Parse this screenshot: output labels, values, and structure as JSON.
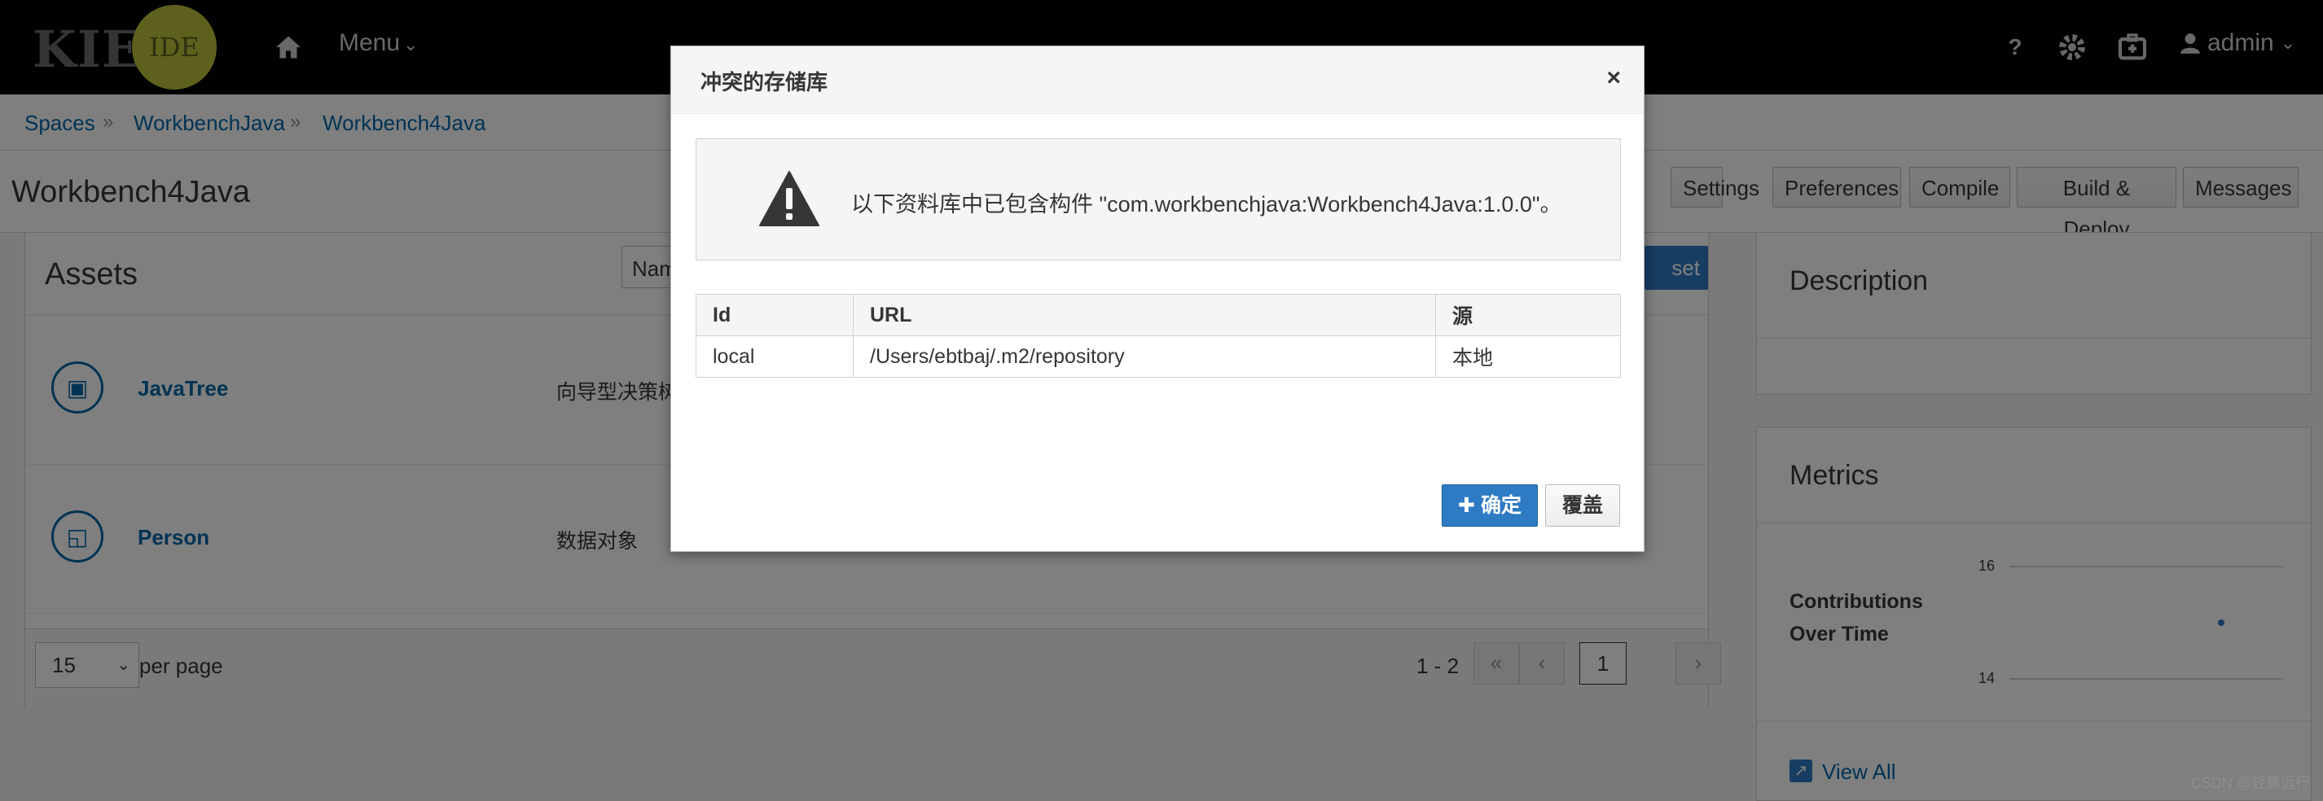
{
  "navbar": {
    "logo_kie": "KIE",
    "logo_ide": "IDE",
    "menu_label": "Menu",
    "help_label": "?",
    "user_label": "admin"
  },
  "breadcrumb": [
    "Spaces",
    "WorkbenchJava",
    "Workbench4Java"
  ],
  "page": {
    "title": "Workbench4Java",
    "buttons": {
      "settings": "Settings",
      "preferences": "Preferences",
      "compile": "Compile",
      "build_deploy": "Build & Deploy",
      "messages": "Messages"
    }
  },
  "assets": {
    "title": "Assets",
    "search_partial": "Nam",
    "add_asset_partial": "set",
    "items": [
      {
        "name": "JavaTree",
        "type": "向导型决策树"
      },
      {
        "name": "Person",
        "type": "数据对象"
      }
    ],
    "per_page_value": "15",
    "per_page_label": "per page",
    "range": "1 - 2",
    "current_page": "1"
  },
  "description": {
    "title": "Description"
  },
  "metrics": {
    "title": "Metrics",
    "label_line1": "Contributions",
    "label_line2": "Over Time",
    "tick_top": "16",
    "tick_bottom": "14",
    "view_all": "View All"
  },
  "modal": {
    "title": "冲突的存储库",
    "close": "×",
    "message": "以下资料库中已包含构件 \"com.workbenchjava:Workbench4Java:1.0.0\"。",
    "table": {
      "headers": [
        "Id",
        "URL",
        "源"
      ],
      "rows": [
        [
          "local",
          "/Users/ebtbaj/.m2/repository",
          "本地"
        ]
      ]
    },
    "ok_label": "确定",
    "overwrite_label": "覆盖"
  },
  "watermark": "CSDN @轻囊远行",
  "colors": {
    "navbar_bg": "#030303",
    "ide_logo": "#bcc33a",
    "link": "#0066a8",
    "primary": "#2e7bc4"
  },
  "icons": [
    "home-icon",
    "chevron-down-icon",
    "help-icon",
    "gear-icon",
    "briefcase-icon",
    "user-icon",
    "warning-icon",
    "plus-icon",
    "view-all-icon",
    "guided-tree-icon",
    "data-object-icon",
    "first-page-icon",
    "prev-page-icon",
    "next-page-icon"
  ]
}
